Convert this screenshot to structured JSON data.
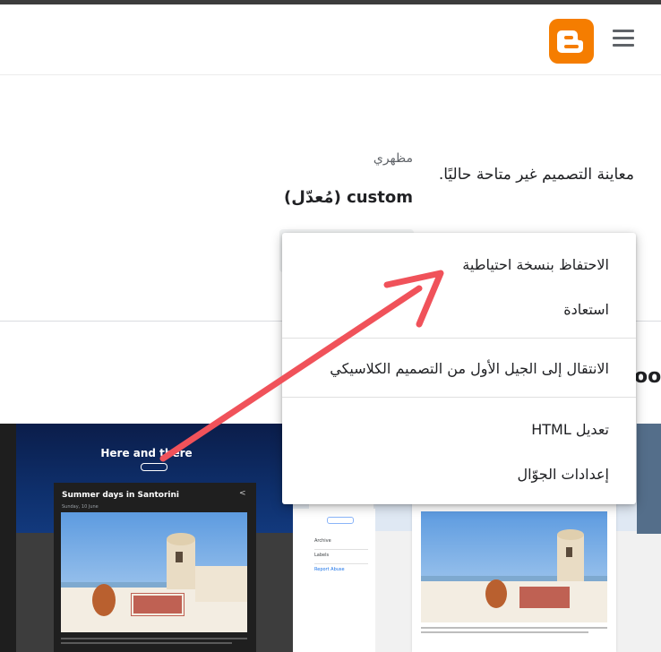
{
  "header": {
    "menu_icon": "hamburger-menu-icon",
    "logo_icon": "blogger-logo-icon"
  },
  "theme": {
    "preview_unavailable": "معاينة التصميم غير متاحة حاليًا.",
    "label": "مظهري",
    "name": "custom (مُعدّل)",
    "cut_off_heading": "oo"
  },
  "menu": {
    "items": [
      "الاحتفاظ بنسخة احتياطية",
      "استعادة",
      "الانتقال إلى الجيل الأول من التصميم الكلاسيكي",
      "تعديل HTML",
      "إعدادات الجوّال"
    ]
  },
  "previews": {
    "dark": {
      "blog_title": "Here and there",
      "post_title": "Summer days in Santorini",
      "post_meta": "Sunday, 10 June",
      "share_icon": "share-icon"
    },
    "light": {
      "sidebar_items": [
        "Archive",
        "Labels",
        "Report Abuse"
      ]
    }
  },
  "annotation": {
    "arrow_color": "#f0525a"
  },
  "colors": {
    "blogger_orange": "#f57d00",
    "menu_text": "#202124",
    "label_gray": "#5f6368"
  }
}
